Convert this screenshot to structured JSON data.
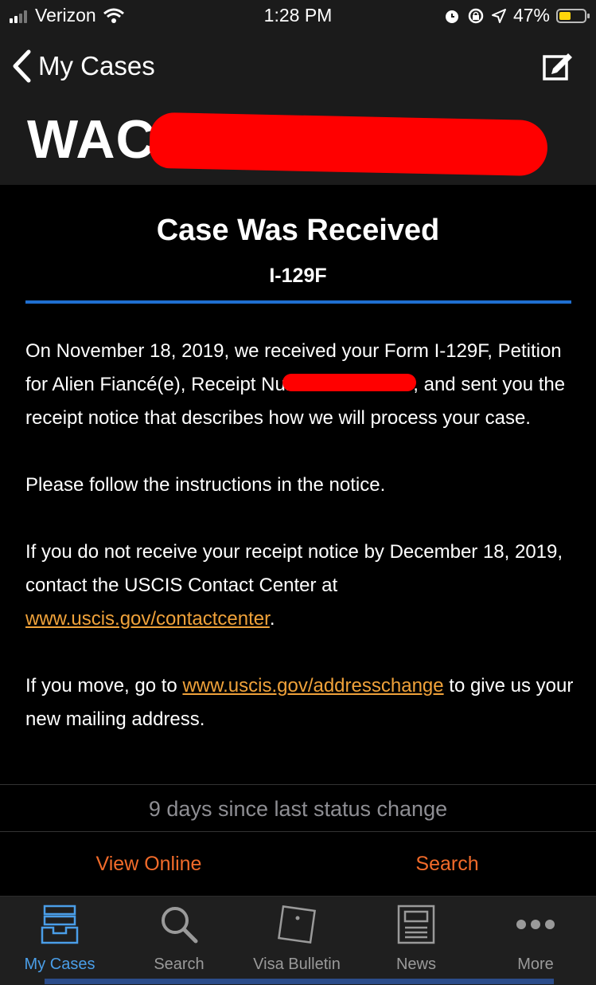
{
  "statusbar": {
    "carrier": "Verizon",
    "time": "1:28 PM",
    "battery": "47%"
  },
  "nav": {
    "back_label": "My Cases",
    "receipt_prefix": "WAC"
  },
  "case": {
    "status_title": "Case Was Received",
    "form_type": "I-129F",
    "para1_a": "On November 18, 2019, we received your Form I-129F, Petition for Alien Fiancé(e), Receipt Number WAC",
    "para1_b": ", and sent you the receipt notice that describes how we will process your case.",
    "para2": "Please follow the instructions in the notice.",
    "para3_a": "If you do not receive your receipt notice by December 18, 2019, contact the USCIS Contact Center at ",
    "para3_link": "www.uscis.gov/contactcenter",
    "para3_b": ".",
    "para4_a": "If you move, go to ",
    "para4_link": "www.uscis.gov/addresschange",
    "para4_b": " to give us your new mailing address."
  },
  "footer": {
    "days_since": "9 days since last status change",
    "view_online": "View Online",
    "search": "Search"
  },
  "tabs": [
    {
      "label": "My Cases",
      "icon": "inbox-tray-icon",
      "active": true
    },
    {
      "label": "Search",
      "icon": "magnifier-icon",
      "active": false
    },
    {
      "label": "Visa Bulletin",
      "icon": "note-pin-icon",
      "active": false
    },
    {
      "label": "News",
      "icon": "newspaper-icon",
      "active": false
    },
    {
      "label": "More",
      "icon": "ellipsis-icon",
      "active": false
    }
  ],
  "colors": {
    "accent_blue": "#1f6fd0",
    "link_orange": "#f0a23a",
    "action_orange": "#f26b2a",
    "redaction_red": "#ff0000"
  }
}
